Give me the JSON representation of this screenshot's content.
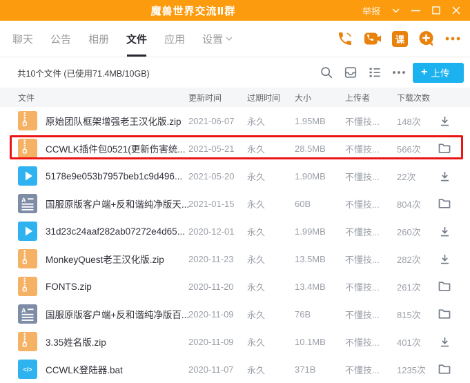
{
  "titlebar": {
    "title": "魔兽世界交流Ⅱ群",
    "report_label": "举报"
  },
  "tabs": [
    {
      "label": "聊天"
    },
    {
      "label": "公告"
    },
    {
      "label": "相册"
    },
    {
      "label": "文件",
      "active": true
    },
    {
      "label": "应用"
    },
    {
      "label": "设置"
    }
  ],
  "tabbar_actions": {
    "voice_call": "voice-call-icon",
    "video_call": "video-call-icon",
    "class_badge_label": "课",
    "invite": "invite-plus-icon",
    "more": "more-icon"
  },
  "toolbar": {
    "summary": "共10个文件 (已使用71.4MB/10GB)",
    "upload_plus": "+",
    "upload_label": "上传"
  },
  "table": {
    "headers": {
      "file": "文件",
      "updated": "更新时间",
      "expire": "过期时间",
      "size": "大小",
      "uploader": "上传者",
      "downloads": "下载次数"
    },
    "rows": [
      {
        "icon": "zip",
        "name": "原始团队框架增强老王汉化版.zip",
        "updated": "2021-06-07",
        "expire": "永久",
        "size": "1.95MB",
        "uploader": "不懂技...",
        "downloads": "148次",
        "action": "download"
      },
      {
        "icon": "zip",
        "name": "CCWLK插件包0521(更新伤害统...",
        "updated": "2021-05-21",
        "expire": "永久",
        "size": "28.5MB",
        "uploader": "不懂技...",
        "downloads": "566次",
        "action": "folder",
        "annotated": true
      },
      {
        "icon": "video",
        "name": "5178e9e053b7957beb1c9d496...",
        "updated": "2021-05-20",
        "expire": "永久",
        "size": "1.90MB",
        "uploader": "不懂技...",
        "downloads": "22次",
        "action": "download"
      },
      {
        "icon": "doc",
        "name": "国服原版客户端+反和谐纯净版天...",
        "updated": "2021-01-15",
        "expire": "永久",
        "size": "60B",
        "uploader": "不懂技...",
        "downloads": "804次",
        "action": "folder"
      },
      {
        "icon": "video",
        "name": "31d23c24aaf282ab07272e4d65...",
        "updated": "2020-12-01",
        "expire": "永久",
        "size": "1.99MB",
        "uploader": "不懂技...",
        "downloads": "260次",
        "action": "download"
      },
      {
        "icon": "zip",
        "name": "MonkeyQuest老王汉化版.zip",
        "updated": "2020-11-23",
        "expire": "永久",
        "size": "13.5MB",
        "uploader": "不懂技...",
        "downloads": "282次",
        "action": "download"
      },
      {
        "icon": "zip",
        "name": "FONTS.zip",
        "updated": "2020-11-20",
        "expire": "永久",
        "size": "13.4MB",
        "uploader": "不懂技...",
        "downloads": "261次",
        "action": "folder"
      },
      {
        "icon": "doc",
        "name": "国服原版客户端+反和谐纯净版百...",
        "updated": "2020-11-09",
        "expire": "永久",
        "size": "76B",
        "uploader": "不懂技...",
        "downloads": "815次",
        "action": "folder"
      },
      {
        "icon": "zip",
        "name": "3.35姓名版.zip",
        "updated": "2020-11-09",
        "expire": "永久",
        "size": "10.1MB",
        "uploader": "不懂技...",
        "downloads": "401次",
        "action": "download"
      },
      {
        "icon": "code",
        "name": "CCWLK登陆器.bat",
        "updated": "2020-11-07",
        "expire": "永久",
        "size": "371B",
        "uploader": "不懂技...",
        "downloads": "1235次",
        "action": "folder"
      }
    ]
  },
  "colors": {
    "titlebar_orange": "#FB9B0D",
    "icon_orange": "#E8820D",
    "upload_blue": "#1BB2EF",
    "zip_icon": "#F5B164",
    "media_icon_blue": "#2FB3F0",
    "doc_icon_slate": "#7E8CA6",
    "annotation_red": "#EC1313"
  }
}
